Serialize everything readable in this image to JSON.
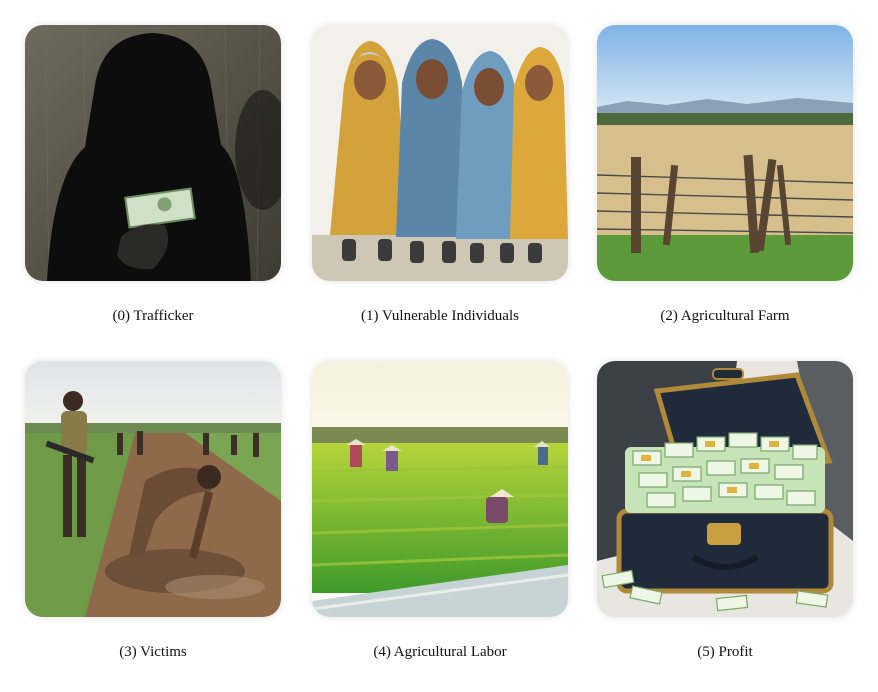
{
  "panels": [
    {
      "index": "(0)",
      "label": "Trafficker",
      "caption": "(0) Trafficker",
      "icon": "hooded-figure-with-money-icon"
    },
    {
      "index": "(1)",
      "label": "Vulnerable Individuals",
      "caption": "(1) Vulnerable Individuals",
      "icon": "hooded-people-group-icon"
    },
    {
      "index": "(2)",
      "label": "Agricultural Farm",
      "caption": "(2) Agricultural Farm",
      "icon": "barbed-wire-field-icon"
    },
    {
      "index": "(3)",
      "label": "Victims",
      "caption": "(3) Victims",
      "icon": "laborers-with-armed-guards-icon"
    },
    {
      "index": "(4)",
      "label": "Agricultural Labor",
      "caption": "(4) Agricultural Labor",
      "icon": "rice-paddy-workers-icon"
    },
    {
      "index": "(5)",
      "label": "Profit",
      "caption": "(5) Profit",
      "icon": "money-chest-icon"
    }
  ]
}
